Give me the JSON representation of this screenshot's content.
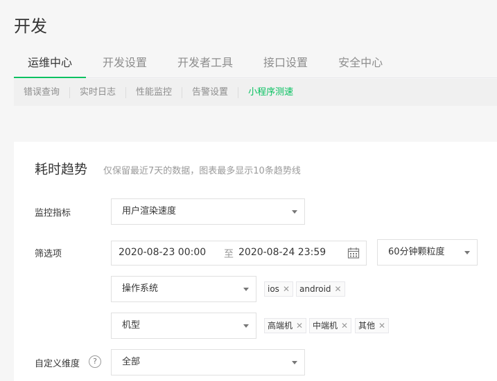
{
  "page": {
    "title": "开发"
  },
  "main_tabs": [
    {
      "label": "运维中心",
      "active": true
    },
    {
      "label": "开发设置",
      "active": false
    },
    {
      "label": "开发者工具",
      "active": false
    },
    {
      "label": "接口设置",
      "active": false
    },
    {
      "label": "安全中心",
      "active": false
    }
  ],
  "sub_tabs": [
    {
      "label": "错误查询",
      "active": false
    },
    {
      "label": "实时日志",
      "active": false
    },
    {
      "label": "性能监控",
      "active": false
    },
    {
      "label": "告警设置",
      "active": false
    },
    {
      "label": "小程序测速",
      "active": true
    }
  ],
  "section": {
    "title": "耗时趋势",
    "hint": "仅保留最近7天的数据，图表最多显示10条趋势线"
  },
  "form": {
    "metric_label": "监控指标",
    "metric_value": "用户渲染速度",
    "filter_label": "筛选项",
    "date_start": "2020-08-23 00:00",
    "date_sep": "至",
    "date_end": "2020-08-24 23:59",
    "granularity": "60分钟颗粒度",
    "os_select": "操作系统",
    "os_tags": [
      "ios",
      "android"
    ],
    "model_select": "机型",
    "model_tags": [
      "高端机",
      "中端机",
      "其他"
    ],
    "custom_label": "自定义维度",
    "custom_help": "?",
    "custom_value": "全部"
  },
  "icons": {
    "calendar": "calendar-icon",
    "caret": "chevron-down-icon",
    "remove": "close-icon",
    "help": "question-circle-icon"
  },
  "colors": {
    "accent": "#07c160",
    "text": "#353535",
    "muted": "#8d8d8d"
  }
}
